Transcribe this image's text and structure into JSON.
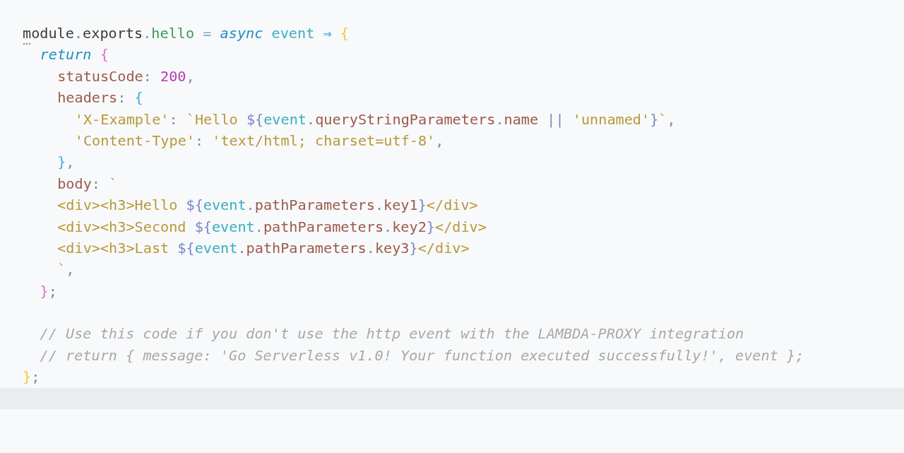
{
  "editor": {
    "lines": [
      {
        "current": false,
        "hint": true,
        "tokens": [
          {
            "kind": "txt",
            "text": "module"
          },
          {
            "kind": "dot",
            "text": "."
          },
          {
            "kind": "txt",
            "text": "exports"
          },
          {
            "kind": "dot",
            "text": "."
          },
          {
            "kind": "fn",
            "text": "hello"
          },
          {
            "kind": "eq",
            "text": " = "
          },
          {
            "kind": "kw",
            "text": "async"
          },
          {
            "kind": "param",
            "text": " event"
          },
          {
            "kind": "op",
            "text": " ⇒ "
          },
          {
            "kind": "b1",
            "text": "{"
          }
        ],
        "children": [
          {
            "current": false,
            "hint": false,
            "tokens": [
              {
                "kind": "kw",
                "text": "return"
              },
              {
                "kind": "b2",
                "text": " {"
              }
            ],
            "children": [
              {
                "current": false,
                "hint": false,
                "tokens": [
                  {
                    "kind": "prop",
                    "text": "statusCode"
                  },
                  {
                    "kind": "dot",
                    "text": ": "
                  },
                  {
                    "kind": "num",
                    "text": "200"
                  },
                  {
                    "kind": "dot",
                    "text": ","
                  }
                ]
              },
              {
                "current": false,
                "hint": false,
                "tokens": [
                  {
                    "kind": "prop",
                    "text": "headers"
                  },
                  {
                    "kind": "dot",
                    "text": ": "
                  },
                  {
                    "kind": "b3",
                    "text": "{"
                  }
                ],
                "children": [
                  {
                    "current": false,
                    "hint": false,
                    "tokens": [
                      {
                        "kind": "str",
                        "text": "'X-Example'"
                      },
                      {
                        "kind": "dot",
                        "text": ": "
                      },
                      {
                        "kind": "str",
                        "text": "`Hello "
                      },
                      {
                        "kind": "interp",
                        "text": "${"
                      },
                      {
                        "kind": "param",
                        "text": "event"
                      },
                      {
                        "kind": "dot",
                        "text": "."
                      },
                      {
                        "kind": "prop",
                        "text": "queryStringParameters"
                      },
                      {
                        "kind": "dot",
                        "text": "."
                      },
                      {
                        "kind": "prop",
                        "text": "name"
                      },
                      {
                        "kind": "interp",
                        "text": " || "
                      },
                      {
                        "kind": "str",
                        "text": "'unnamed'"
                      },
                      {
                        "kind": "interp",
                        "text": "}"
                      },
                      {
                        "kind": "str",
                        "text": "`"
                      },
                      {
                        "kind": "dot",
                        "text": ","
                      }
                    ]
                  },
                  {
                    "current": false,
                    "hint": false,
                    "tokens": [
                      {
                        "kind": "str",
                        "text": "'Content-Type'"
                      },
                      {
                        "kind": "dot",
                        "text": ": "
                      },
                      {
                        "kind": "str",
                        "text": "'text/html; charset=utf-8'"
                      },
                      {
                        "kind": "dot",
                        "text": ","
                      }
                    ]
                  }
                ]
              },
              {
                "current": false,
                "hint": false,
                "tokens": [
                  {
                    "kind": "b3",
                    "text": "}"
                  },
                  {
                    "kind": "dot",
                    "text": ","
                  }
                ]
              },
              {
                "current": false,
                "hint": false,
                "tokens": [
                  {
                    "kind": "prop",
                    "text": "body"
                  },
                  {
                    "kind": "dot",
                    "text": ": "
                  },
                  {
                    "kind": "str",
                    "text": "`"
                  }
                ]
              },
              {
                "current": false,
                "hint": false,
                "tokens": [
                  {
                    "kind": "str",
                    "text": "<div><h3>Hello "
                  },
                  {
                    "kind": "interp",
                    "text": "${"
                  },
                  {
                    "kind": "param",
                    "text": "event"
                  },
                  {
                    "kind": "dot",
                    "text": "."
                  },
                  {
                    "kind": "prop",
                    "text": "pathParameters"
                  },
                  {
                    "kind": "dot",
                    "text": "."
                  },
                  {
                    "kind": "prop",
                    "text": "key1"
                  },
                  {
                    "kind": "interp",
                    "text": "}"
                  },
                  {
                    "kind": "str",
                    "text": "</div>"
                  }
                ]
              },
              {
                "current": false,
                "hint": false,
                "tokens": [
                  {
                    "kind": "str",
                    "text": "<div><h3>Second "
                  },
                  {
                    "kind": "interp",
                    "text": "${"
                  },
                  {
                    "kind": "param",
                    "text": "event"
                  },
                  {
                    "kind": "dot",
                    "text": "."
                  },
                  {
                    "kind": "prop",
                    "text": "pathParameters"
                  },
                  {
                    "kind": "dot",
                    "text": "."
                  },
                  {
                    "kind": "prop",
                    "text": "key2"
                  },
                  {
                    "kind": "interp",
                    "text": "}"
                  },
                  {
                    "kind": "str",
                    "text": "</div>"
                  }
                ]
              },
              {
                "current": false,
                "hint": false,
                "tokens": [
                  {
                    "kind": "str",
                    "text": "<div><h3>Last "
                  },
                  {
                    "kind": "interp",
                    "text": "${"
                  },
                  {
                    "kind": "param",
                    "text": "event"
                  },
                  {
                    "kind": "dot",
                    "text": "."
                  },
                  {
                    "kind": "prop",
                    "text": "pathParameters"
                  },
                  {
                    "kind": "dot",
                    "text": "."
                  },
                  {
                    "kind": "prop",
                    "text": "key3"
                  },
                  {
                    "kind": "interp",
                    "text": "}"
                  },
                  {
                    "kind": "str",
                    "text": "</div>"
                  }
                ]
              },
              {
                "current": false,
                "hint": false,
                "tokens": [
                  {
                    "kind": "str",
                    "text": "`"
                  },
                  {
                    "kind": "dot",
                    "text": ","
                  }
                ]
              }
            ]
          },
          {
            "current": false,
            "hint": false,
            "tokens": [
              {
                "kind": "b2",
                "text": "}"
              },
              {
                "kind": "dot",
                "text": ";"
              }
            ]
          },
          {
            "current": false
          },
          {
            "current": false,
            "hint": false,
            "tokens": [
              {
                "kind": "cmt",
                "text": "// Use this code if you don't use the http event with the LAMBDA-PROXY integration"
              }
            ]
          },
          {
            "current": false,
            "hint": false,
            "tokens": [
              {
                "kind": "cmt",
                "text": "// return { message: 'Go Serverless v1.0! Your function executed successfully!', event };"
              }
            ]
          }
        ]
      },
      {
        "current": false,
        "hint": false,
        "tokens": [
          {
            "kind": "b1",
            "text": "}"
          },
          {
            "kind": "dot",
            "text": ";"
          }
        ]
      },
      {
        "current": true
      }
    ]
  }
}
